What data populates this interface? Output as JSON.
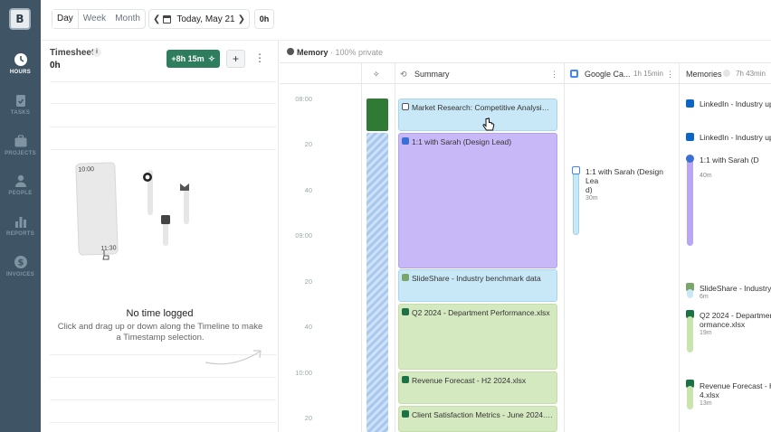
{
  "nav": {
    "items": [
      {
        "label": "HOURS",
        "icon": "clock-icon",
        "active": true
      },
      {
        "label": "TASKS",
        "icon": "clipboard-icon",
        "active": false
      },
      {
        "label": "PROJECTS",
        "icon": "briefcase-icon",
        "active": false
      },
      {
        "label": "PEOPLE",
        "icon": "person-icon",
        "active": false
      },
      {
        "label": "REPORTS",
        "icon": "bar-chart-icon",
        "active": false
      },
      {
        "label": "INVOICES",
        "icon": "dollar-icon",
        "active": false
      }
    ]
  },
  "toolbar": {
    "views": [
      "Day",
      "Week",
      "Month"
    ],
    "selected_view": "Day",
    "date": "Today, May 21",
    "hours_chip": "0h"
  },
  "timesheet": {
    "title": "Timesheet",
    "info": "i",
    "total": "0h",
    "add_label": "+8h 15m",
    "plus": "+",
    "more": "⋮",
    "illus_start": "10:00",
    "illus_end": "11:30",
    "empty_title": "No time logged",
    "empty_desc": "Click and drag up or down along the Timeline to make a Timestamp selection."
  },
  "memory": {
    "label": "Memory",
    "privacy": "· 100% private",
    "columns": {
      "summary": {
        "title": "Summary"
      },
      "google": {
        "title": "Google Ca...",
        "duration": "1h 15min"
      },
      "memories": {
        "title": "Memories",
        "duration": "7h 43min"
      }
    },
    "time_labels": [
      "08:00",
      "20",
      "40",
      "09:00",
      "20",
      "40",
      "10:00",
      "20"
    ],
    "summary_events": [
      {
        "title": "Market Research: Competitive Analysis Q3 ...",
        "color": "#c9e8f7"
      },
      {
        "title": "1:1 with Sarah (Design Lead)",
        "color": "#c8b8f7"
      },
      {
        "title": "SlideShare - Industry benchmark data",
        "color": "#c9e8f7"
      },
      {
        "title": "Q2 2024 - Department Performance.xlsx",
        "color": "#d5e9c0"
      },
      {
        "title": "Revenue Forecast - H2 2024.xlsx",
        "color": "#d5e9c0"
      },
      {
        "title": "Client Satisfaction Metrics - June 2024.xlsx",
        "color": "#d5e9c0"
      }
    ],
    "google_events": [
      {
        "title_line1": "1:1 with Sarah (Design Lea",
        "title_line2": "d)",
        "meta": "30m"
      }
    ],
    "memories_items": [
      {
        "title": "LinkedIn - Industry upd",
        "meta": ""
      },
      {
        "title": "LinkedIn - Industry upd",
        "meta": ""
      },
      {
        "title_line1": "1:1 with Sarah (D",
        "title_line2": "",
        "meta": "40m"
      },
      {
        "title": "SlideShare - Industry be",
        "meta": "6m"
      },
      {
        "title_line1": "Q2 2024 - Department P",
        "title_line2": "ormance.xlsx",
        "meta": "19m"
      },
      {
        "title_line1": "Revenue Forecast - H2 2",
        "title_line2": "4.xlsx",
        "meta": "13m"
      }
    ]
  }
}
